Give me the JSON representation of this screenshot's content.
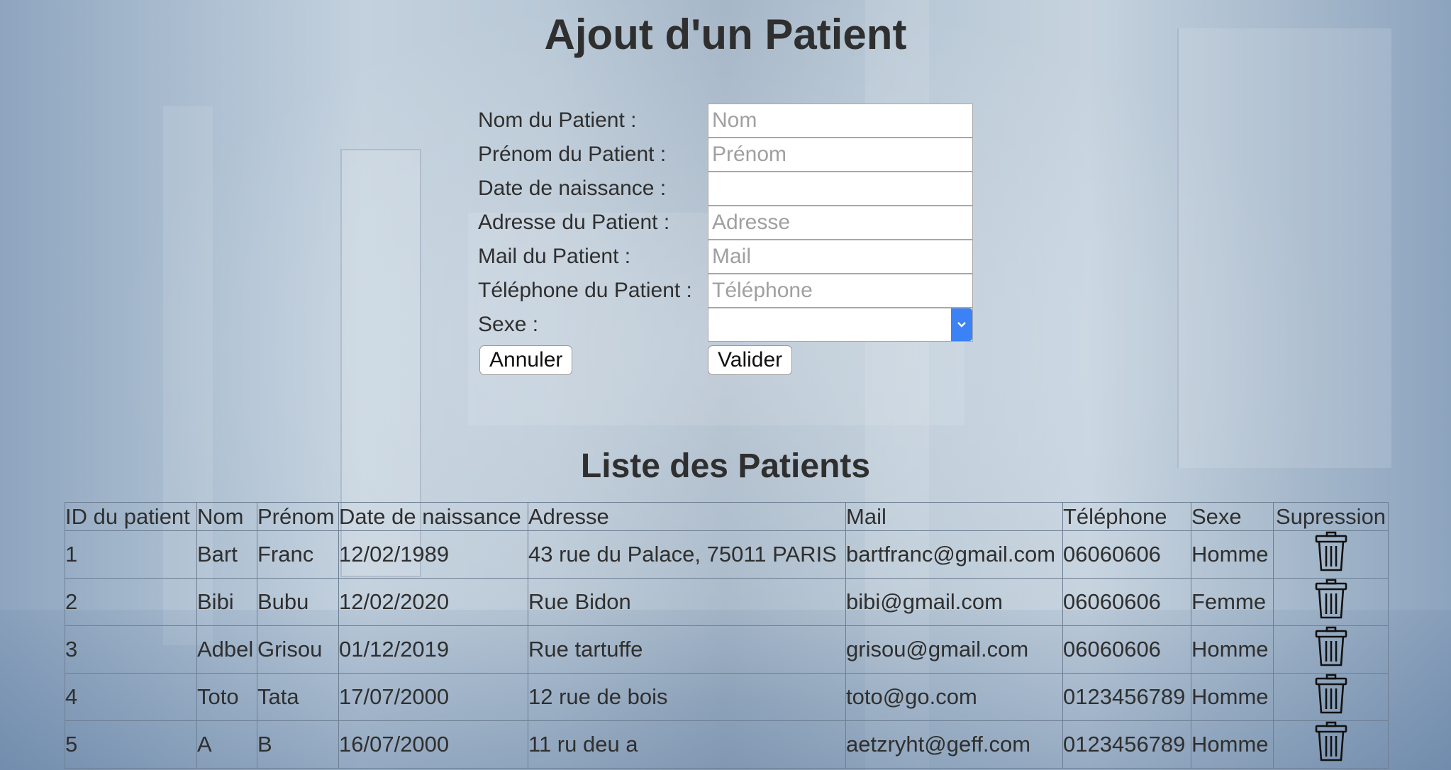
{
  "page": {
    "title": "Ajout d'un Patient",
    "list_title": "Liste des Patients"
  },
  "form": {
    "fields": [
      {
        "label": "Nom du Patient :",
        "placeholder": "Nom",
        "value": ""
      },
      {
        "label": "Prénom du Patient :",
        "placeholder": "Prénom",
        "value": ""
      },
      {
        "label": "Date de naissance :",
        "placeholder": "",
        "value": ""
      },
      {
        "label": "Adresse du Patient :",
        "placeholder": "Adresse",
        "value": ""
      },
      {
        "label": "Mail du Patient :",
        "placeholder": "Mail",
        "value": ""
      },
      {
        "label": "Téléphone du Patient :",
        "placeholder": "Téléphone",
        "value": ""
      }
    ],
    "sexe": {
      "label": "Sexe :",
      "selected": ""
    },
    "cancel_label": "Annuler",
    "submit_label": "Valider"
  },
  "table": {
    "headers": [
      "ID du patient",
      "Nom",
      "Prénom",
      "Date de naissance",
      "Adresse",
      "Mail",
      "Téléphone",
      "Sexe",
      "Supression"
    ],
    "rows": [
      [
        "1",
        "Bart",
        "Franc",
        "12/02/1989",
        "43 rue du Palace, 75011 PARIS",
        "bartfranc@gmail.com",
        "06060606",
        "Homme"
      ],
      [
        "2",
        "Bibi",
        "Bubu",
        "12/02/2020",
        "Rue Bidon",
        "bibi@gmail.com",
        "06060606",
        "Femme"
      ],
      [
        "3",
        "Adbel",
        "Grisou",
        "01/12/2019",
        "Rue tartuffe",
        "grisou@gmail.com",
        "06060606",
        "Homme"
      ],
      [
        "4",
        "Toto",
        "Tata",
        "17/07/2000",
        "12 rue de bois",
        "toto@go.com",
        "0123456789",
        "Homme"
      ],
      [
        "5",
        "A",
        "B",
        "16/07/2000",
        "11 ru deu a",
        "aetzryht@geff.com",
        "0123456789",
        "Homme"
      ]
    ],
    "delete_icon": "trash-icon"
  },
  "colors": {
    "text": "#2f2f2f",
    "select_accent": "#3b82f6",
    "table_border": "#6e7f93"
  }
}
